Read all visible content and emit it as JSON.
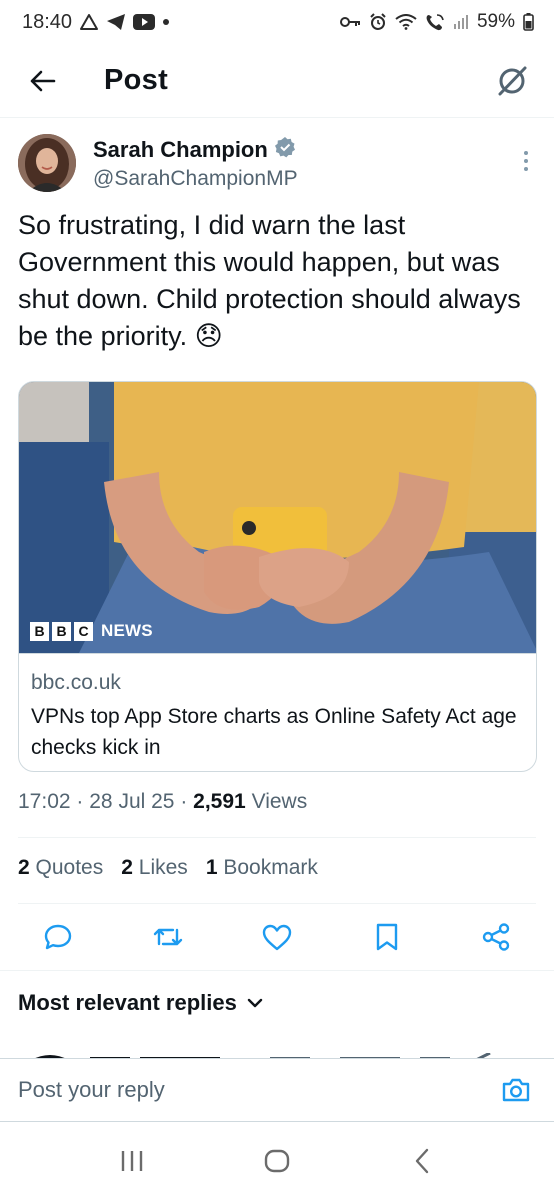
{
  "status_bar": {
    "time": "18:40",
    "battery": "59%",
    "left_icons": [
      "alert-triangle-icon",
      "telegram-icon",
      "youtube-icon",
      "dot-icon"
    ],
    "right_icons": [
      "key-icon",
      "alarm-icon",
      "wifi-icon",
      "wifi-calling-icon",
      "signal-icon",
      "battery-icon"
    ]
  },
  "header": {
    "title": "Post"
  },
  "author": {
    "name": "Sarah Champion",
    "handle": "@SarahChampionMP",
    "verified_color": "#829aab"
  },
  "tweet": {
    "text": "So frustrating, I did warn the last Government this would happen, but was shut down. Child protection should always be the priority. 😞"
  },
  "card": {
    "source_badge": "NEWS",
    "badge_letters": [
      "B",
      "B",
      "C"
    ],
    "domain": "bbc.co.uk",
    "title": "VPNs top App Store charts as Online Safety Act age checks kick in"
  },
  "meta": {
    "time": "17:02",
    "date": "28 Jul 25",
    "views_count": "2,591",
    "views_label": "Views",
    "separator": "·"
  },
  "stats": [
    {
      "count": "2",
      "label": "Quotes"
    },
    {
      "count": "2",
      "label": "Likes"
    },
    {
      "count": "1",
      "label": "Bookmark"
    }
  ],
  "actions": [
    "reply-icon",
    "retweet-icon",
    "like-icon",
    "bookmark-icon",
    "share-icon"
  ],
  "replies": {
    "sort_label": "Most relevant replies"
  },
  "reply_bar": {
    "placeholder": "Post your reply"
  },
  "colors": {
    "accent": "#1d9bf0",
    "muted_text": "#536471",
    "text": "#0f1419"
  }
}
